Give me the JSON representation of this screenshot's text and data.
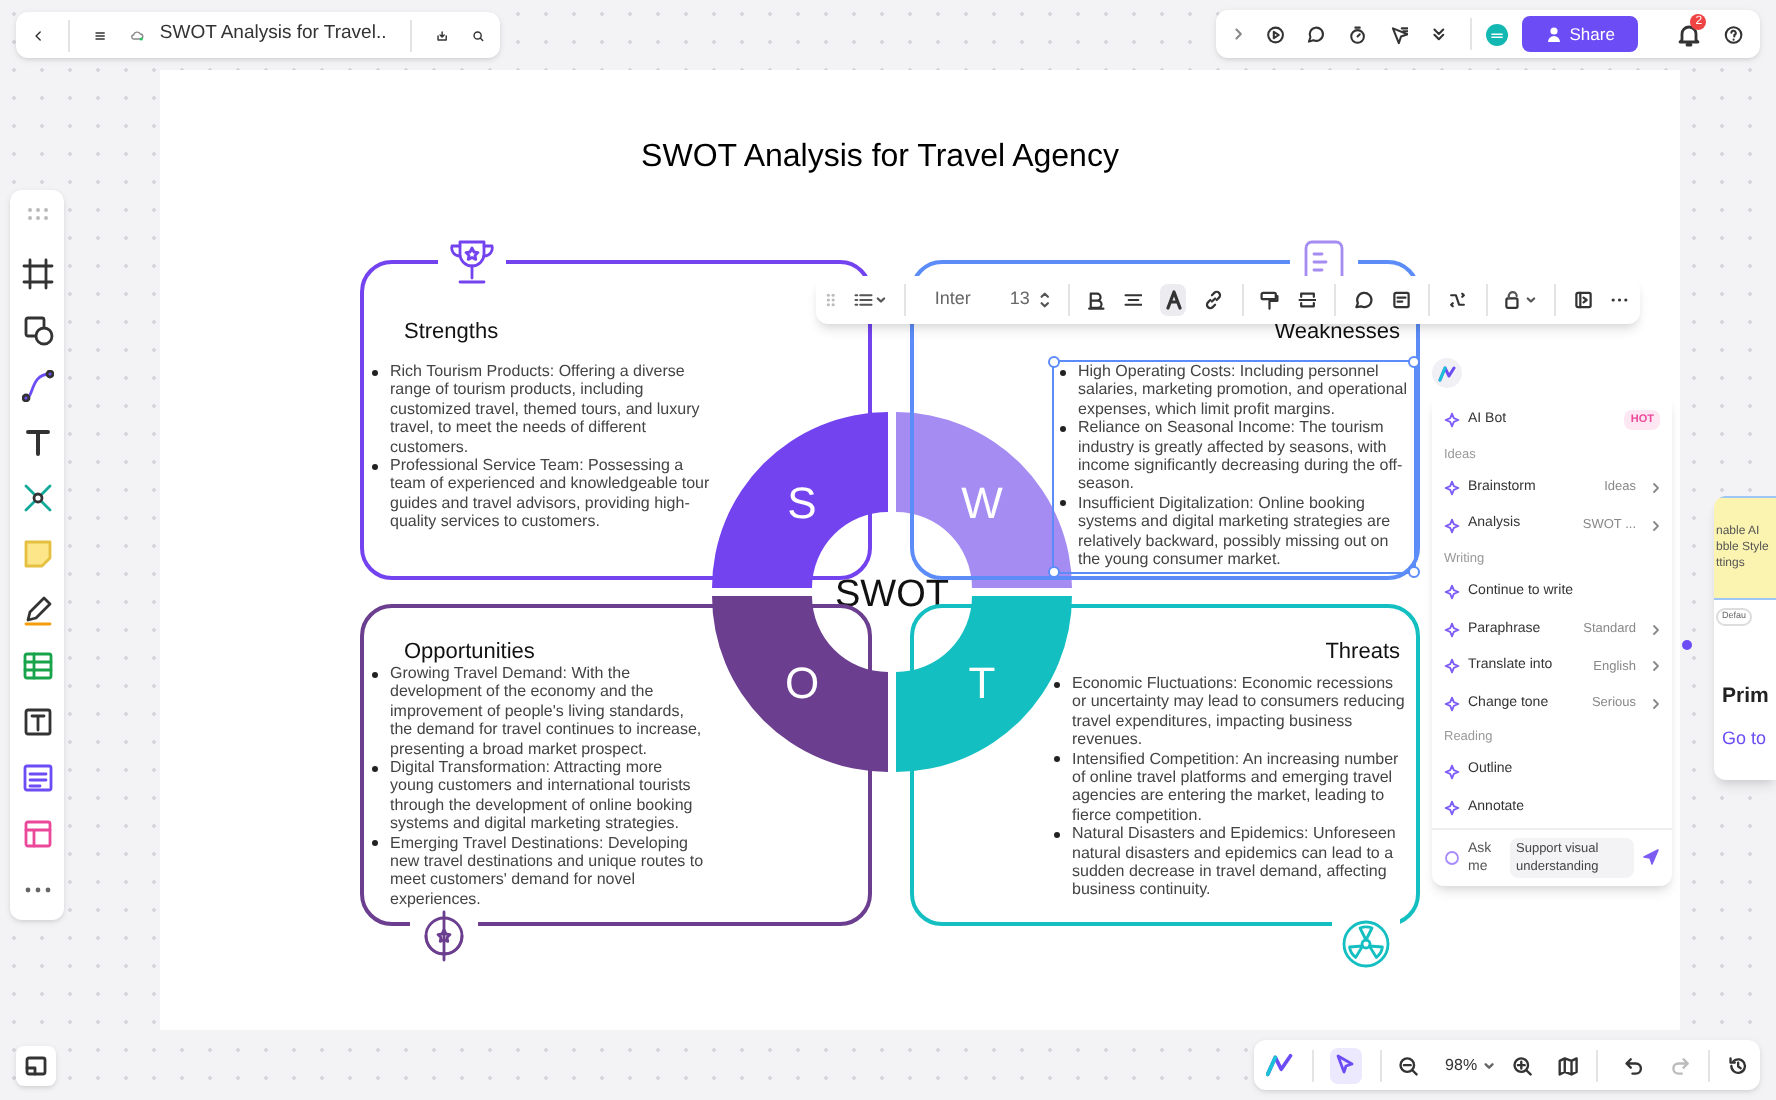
{
  "top_bar": {
    "title": "SWOT Analysis for Travel..",
    "share": "Share",
    "notifications": "2"
  },
  "diagram": {
    "title": "SWOT Analysis for Travel Agency",
    "center": "SWOT",
    "quadrants": [
      {
        "heading": "Strengths",
        "letter": "S",
        "color": "#7443f0",
        "selected": false,
        "items": [
          "Rich Tourism Products: Offering a diverse range of tourism products, including customized travel, themed tours, and luxury travel, to meet the needs of different customers.",
          "Professional Service Team: Possessing a team of experienced and knowledgeable tour guides and travel advisors, providing high-quality services to customers."
        ]
      },
      {
        "heading": "Weaknesses",
        "letter": "W",
        "color": "#a48cf2",
        "selected": true,
        "items": [
          "High Operating Costs: Including personnel salaries, marketing promotion, and operational expenses, which limit profit margins.",
          "Reliance on Seasonal Income: The tourism industry is greatly affected by seasons, with income significantly decreasing during the off-season.",
          "Insufficient Digitalization: Online booking systems and digital marketing strategies are relatively backward, possibly missing out on the young consumer market."
        ]
      },
      {
        "heading": "Opportunities",
        "letter": "O",
        "color": "#6b3e8f",
        "selected": false,
        "items": [
          "Growing Travel Demand: With the development of the economy and the improvement of people's living standards, the demand for travel continues to increase, presenting a broad market prospect.",
          "Digital Transformation: Attracting more young customers and international tourists through the development of online booking systems and digital marketing strategies.",
          "Emerging Travel Destinations: Developing new travel destinations and unique routes to meet customers' demand for novel experiences."
        ]
      },
      {
        "heading": "Threats",
        "letter": "T",
        "color": "#14bfc2",
        "selected": false,
        "items": [
          "Economic Fluctuations: Economic recessions or uncertainty may lead to consumers reducing travel expenditures, impacting business revenues.",
          "Intensified Competition: An increasing number of online travel platforms and emerging travel agencies are entering the market, leading to fierce competition.",
          "Natural Disasters and Epidemics: Unforeseen natural disasters and epidemics can lead to a sudden decrease in travel demand, affecting business continuity."
        ]
      }
    ]
  },
  "text_toolbar": {
    "font": "Inter",
    "size": "13",
    "text_color_selected": true
  },
  "ai_panel": {
    "items": [
      {
        "kind": "header",
        "label": "AI Bot",
        "badge": "HOT"
      },
      {
        "kind": "section",
        "label": "Ideas"
      },
      {
        "kind": "action",
        "label": "Brainstorm",
        "option": "Ideas"
      },
      {
        "kind": "action",
        "label": "Analysis",
        "option": "SWOT ..."
      },
      {
        "kind": "section",
        "label": "Writing"
      },
      {
        "kind": "action",
        "label": "Continue to write"
      },
      {
        "kind": "action",
        "label": "Paraphrase",
        "option": "Standard"
      },
      {
        "kind": "action",
        "label": "Translate into",
        "option": "English"
      },
      {
        "kind": "action",
        "label": "Change tone",
        "option": "Serious"
      },
      {
        "kind": "section",
        "label": "Reading"
      },
      {
        "kind": "action",
        "label": "Outline"
      },
      {
        "kind": "action",
        "label": "Annotate"
      }
    ],
    "ask_label": "Ask me",
    "ask_value": "Support visual understanding"
  },
  "side_card": {
    "image_text": "nable AI bble Style ttings",
    "tag": "Defau",
    "title": "Prim",
    "link": "Go to"
  },
  "bottom_bar": {
    "zoom": "98%",
    "pointer_selected": true
  }
}
